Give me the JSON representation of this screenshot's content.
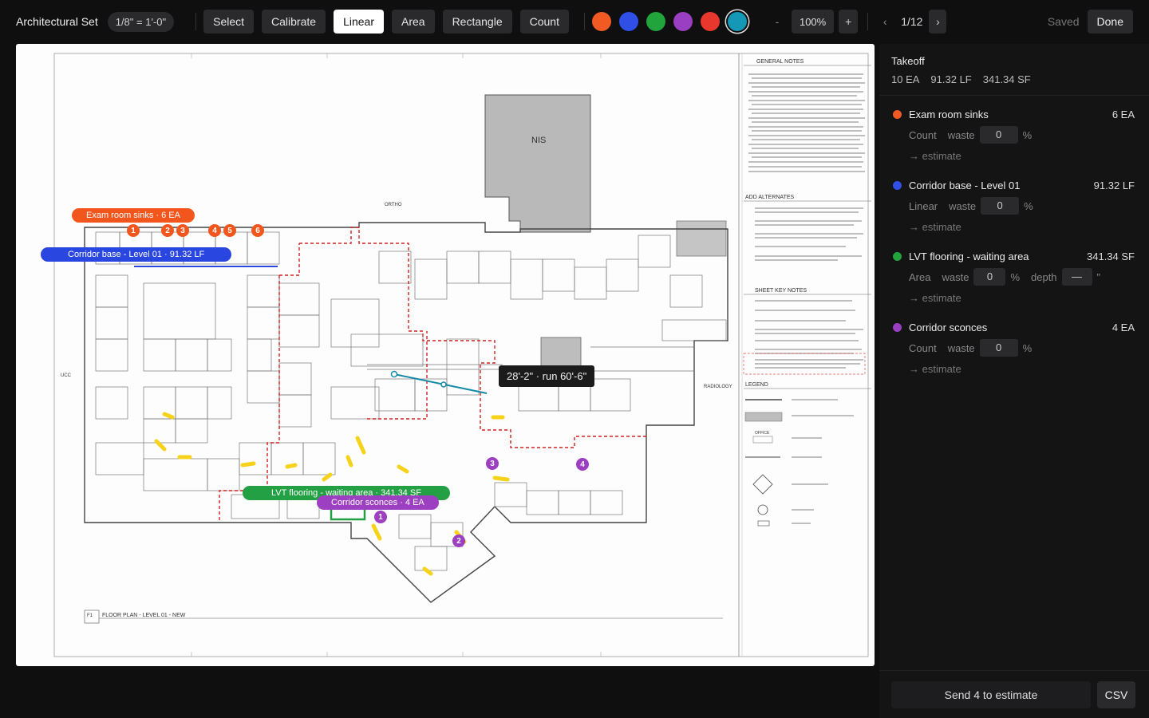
{
  "toolbar": {
    "title": "Architectural Set",
    "scale": "1/8\" = 1'-0\"",
    "tools": [
      "Select",
      "Calibrate",
      "Linear",
      "Area",
      "Rectangle",
      "Count"
    ],
    "active_tool": "Linear",
    "colors": [
      "#f15a22",
      "#2f4fe6",
      "#22a43d",
      "#9b3fc2",
      "#e8382e",
      "#1597b6"
    ],
    "selected_color": "#1597b6",
    "zoom_minus": "-",
    "zoom": "100%",
    "zoom_plus": "+",
    "page_prev": "‹",
    "page": "1/12",
    "page_next": "›",
    "saved": "Saved",
    "done": "Done"
  },
  "drawing": {
    "nis_label": "NIS",
    "ortho_label": "ORTHO",
    "ucc_label": "UCC",
    "radiology_label": "RADIOLOGY",
    "sheet_title": "FLOOR PLAN - LEVEL 01 - NEW",
    "sheet_ref": "F1",
    "notes": {
      "general": "GENERAL NOTES",
      "alternates": "ADD ALTERNATES",
      "keynotes": "SHEET KEY NOTES",
      "legend": "LEGEND",
      "office": "OFFICE"
    },
    "tags": {
      "sinks": "Exam room sinks · 6 EA",
      "corridor_base": "Corridor base - Level 01 · 91.32 LF",
      "lvt": "LVT flooring - waiting area · 341.34 SF",
      "sconces": "Corridor sconces · 4 EA"
    },
    "sink_marks": [
      "1",
      "2",
      "3",
      "4",
      "5",
      "6"
    ],
    "sconce_marks": [
      "1",
      "2",
      "3",
      "4"
    ],
    "measure_tooltip": "28'-2\" · run 60'-6\""
  },
  "panel": {
    "title": "Takeoff",
    "totals": [
      "10 EA",
      "91.32 LF",
      "341.34 SF"
    ],
    "items": [
      {
        "name": "Exam room sinks",
        "qty": "6 EA",
        "color": "#f15a22",
        "type": "Count",
        "waste": "0",
        "waste_label": "waste",
        "pct": "%",
        "estimate": "→ estimate"
      },
      {
        "name": "Corridor base - Level 01",
        "qty": "91.32 LF",
        "color": "#2f4fe6",
        "type": "Linear",
        "waste": "0",
        "waste_label": "waste",
        "pct": "%",
        "estimate": "→ estimate"
      },
      {
        "name": "LVT flooring - waiting area",
        "qty": "341.34 SF",
        "color": "#22a43d",
        "type": "Area",
        "waste": "0",
        "waste_label": "waste",
        "pct": "%",
        "depth_label": "depth",
        "depth": "—",
        "depth_unit": "\"",
        "estimate": "→ estimate"
      },
      {
        "name": "Corridor sconces",
        "qty": "4 EA",
        "color": "#9b3fc2",
        "type": "Count",
        "waste": "0",
        "waste_label": "waste",
        "pct": "%",
        "estimate": "→ estimate"
      }
    ],
    "send_button": "Send 4 to estimate",
    "csv_button": "CSV"
  }
}
